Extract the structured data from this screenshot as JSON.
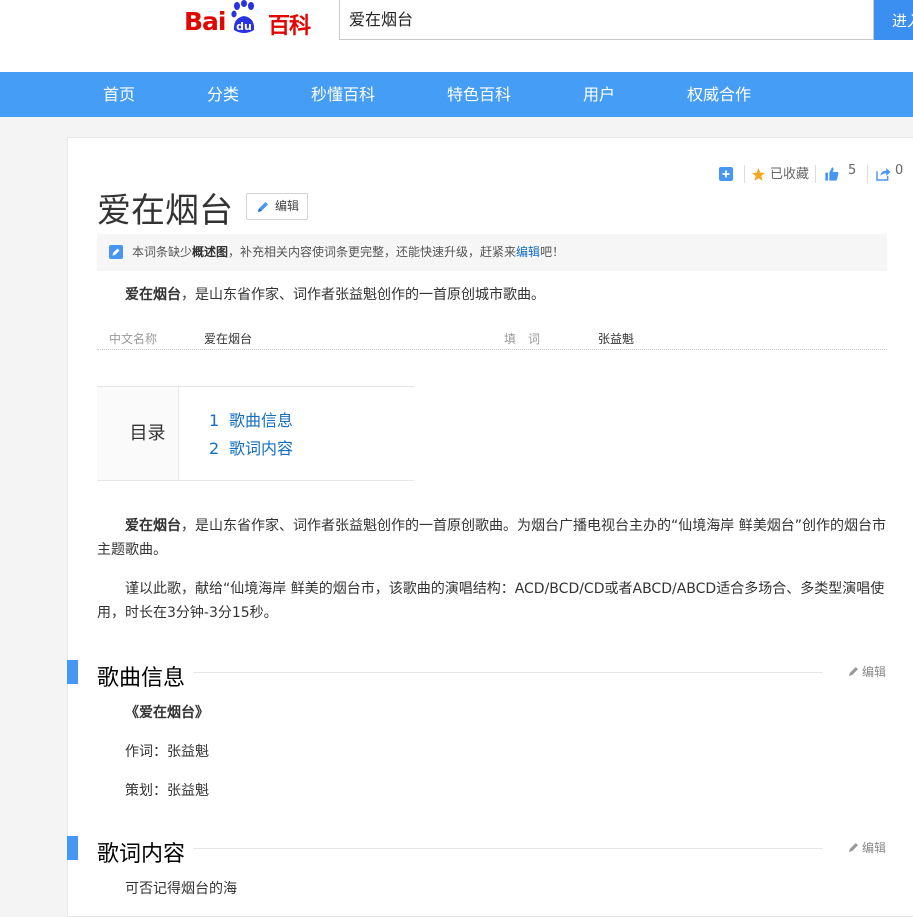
{
  "header": {
    "logo_bai": "Bai",
    "logo_du": "du",
    "logo_baike": "百科",
    "search_value": "爱在烟台",
    "search_button": "进入"
  },
  "nav": [
    "首页",
    "分类",
    "秒懂百科",
    "特色百科",
    "用户",
    "权威合作"
  ],
  "tools": {
    "collected": "已收藏",
    "like_count": "5",
    "share_count": "0"
  },
  "article": {
    "title": "爱在烟台",
    "edit_label": "编辑",
    "notice": {
      "pre": "本词条缺少",
      "bold": "概述图",
      "mid": "，补充相关内容使词条更完整，还能快速升级，赶紧来",
      "link": "编辑",
      "post": "吧！"
    },
    "summary_bold": "爱在烟台",
    "summary_rest": "，是山东省作家、词作者张益魁创作的一首原创城市歌曲。",
    "info": [
      {
        "key": "中文名称",
        "value": "爱在烟台"
      },
      {
        "key": "填　词",
        "value": "张益魁"
      }
    ],
    "toc_label": "目录",
    "toc": [
      {
        "num": "1",
        "label": "歌曲信息"
      },
      {
        "num": "2",
        "label": "歌词内容"
      }
    ],
    "para1_bold": "爱在烟台",
    "para1_rest": "，是山东省作家、词作者张益魁创作的一首原创歌曲。为烟台广播电视台主办的“仙境海岸 鲜美烟台”创作的烟台市主题歌曲。",
    "para2": "谨以此歌，献给“仙境海岸 鲜美的烟台市，该歌曲的演唱结构：ACD/BCD/CD或者ABCD/ABCD适合多场合、多类型演唱使用，时长在3分钟-3分15秒。",
    "sections": [
      {
        "title": "歌曲信息",
        "edit": "编辑"
      },
      {
        "title": "歌词内容",
        "edit": "编辑"
      }
    ],
    "song_info": [
      "《爱在烟台》",
      "作词：张益魁",
      "策划：张益魁"
    ],
    "lyrics_first": "可否记得烟台的海"
  },
  "colors": {
    "brand_red": "#e10602",
    "brand_blue": "#2932e1",
    "nav": "#459df5",
    "link": "#136ec2"
  }
}
